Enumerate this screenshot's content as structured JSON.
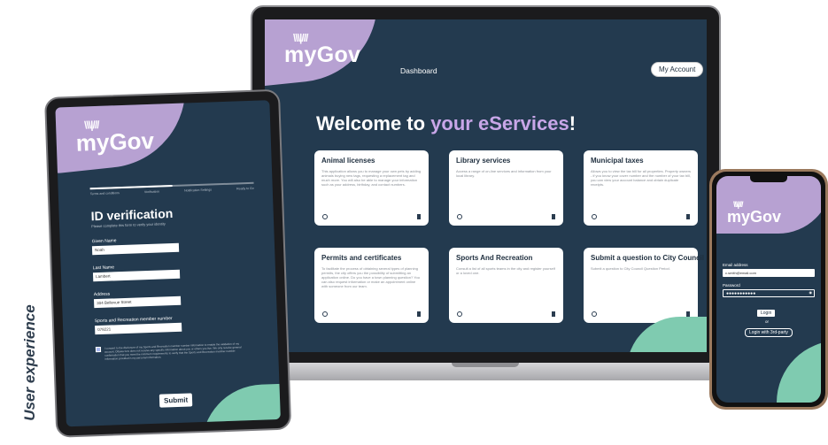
{
  "caption": "User experience",
  "brand": {
    "logo": "myGov",
    "sun_glyph": "\\\\\\|///"
  },
  "laptop": {
    "nav": {
      "dashboard": "Dashboard",
      "account_button": "My Account"
    },
    "welcome": {
      "prefix": "Welcome to ",
      "accent": "your eServices",
      "suffix": "!"
    },
    "cards": [
      {
        "title": "Animal licenses",
        "text": "This application allows you to manage your own pets by adding animals buying new tags, requesting a replacement tag and much more. You will also be able to manage your information such as your address, birthday, and contact numbers."
      },
      {
        "title": "Library services",
        "text": "Access a range of on-line services and information from your local library."
      },
      {
        "title": "Municipal taxes",
        "text": "Allows you to view the tax bill for all properties. Property owners - if you know your cover number and the number of your tax bill, you can view your account balance and obtain duplicate receipts."
      },
      {
        "title": "Permits and certificates",
        "text": "To facilitate the process of obtaining several types of planning permits, the city offers you the possibility of submitting an application online. Do you have a town planning question? You can also request information or make an appointment online with someone from our team."
      },
      {
        "title": "Sports And Recreation",
        "text": "Consult a list of all sports teams in the city and register yourself or a loved one."
      },
      {
        "title": "Submit a question to City Council",
        "text": "Submit a question to City Council Question Period."
      }
    ],
    "colors": {
      "background": "#233a4f",
      "accent": "#c8a6e8",
      "blob_purple": "#b7a1d2",
      "blob_green": "#7fcbb0"
    }
  },
  "tablet": {
    "progress": {
      "completed_fraction": 0.5,
      "steps": [
        "Terms and conditions",
        "Verification",
        "Notification Settings",
        "Ready to Go"
      ]
    },
    "heading": "ID verification",
    "subheading": "Please complete this form to verify your identity",
    "fields": [
      {
        "label": "Given Name",
        "value": "Noah"
      },
      {
        "label": "Last Name",
        "value": "Lambert"
      },
      {
        "label": "Address",
        "value": "304 Bellevue Street"
      },
      {
        "label": "Sports and Recreation member number",
        "value": "078221"
      }
    ],
    "consent_text": "I consent to the disclosure of my Sports and Recreation member number information to enable the validation of my account. Ottawa Gov does not receive any specific information about you or others you live. We only receive general confirmation that you meet the minimum requirements to verify that the Sports and Recreation member number information provided is my personal information.",
    "consent_checked": true,
    "submit_label": "Submit"
  },
  "phone": {
    "email_label": "Email address",
    "email_value": "c.smith@email.com",
    "password_label": "Password",
    "password_value": "●●●●●●●●●●●",
    "login_label": "Login",
    "or_label": "or",
    "login_third_party_label": "Login with 3rd-party",
    "eye_icon": "eye-icon"
  }
}
